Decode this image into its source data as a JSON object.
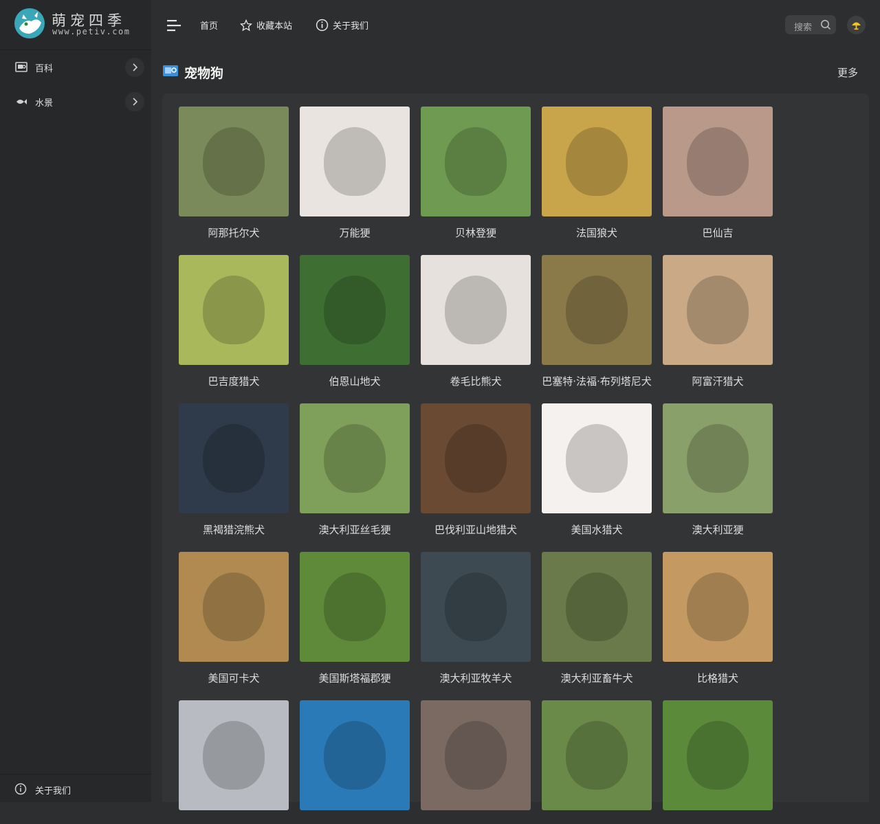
{
  "brand": {
    "name": "萌宠四季",
    "url": "www.petiv.com"
  },
  "sidebar": {
    "items": [
      {
        "label": "百科",
        "icon": "encyclopedia-icon"
      },
      {
        "label": "水景",
        "icon": "fish-icon"
      }
    ],
    "bottom": {
      "label": "关于我们",
      "icon": "info-icon"
    }
  },
  "header": {
    "menu_icon": "menu-icon",
    "nav": [
      {
        "label": "首页",
        "icon": ""
      },
      {
        "label": "收藏本站",
        "icon": "star-icon"
      },
      {
        "label": "关于我们",
        "icon": "info-icon"
      }
    ],
    "search_label": "搜索",
    "theme_icon": "theme-toggle-icon"
  },
  "section": {
    "title": "宠物狗",
    "more": "更多"
  },
  "colors": {
    "page_bg": "#2c2e2f",
    "sidebar_bg": "#262829",
    "panel_bg": "#323435",
    "accent": "#f5c518",
    "section_icon": "#3a8fd9"
  },
  "breeds": [
    {
      "name": "阿那托尔犬",
      "color": "#7a8a5a"
    },
    {
      "name": "万能㹴",
      "color": "#e9e4df"
    },
    {
      "name": "贝林登㹴",
      "color": "#6f9a52"
    },
    {
      "name": "法国狼犬",
      "color": "#c8a44a"
    },
    {
      "name": "巴仙吉",
      "color": "#b9998a"
    },
    {
      "name": "巴吉度猎犬",
      "color": "#a9b85a"
    },
    {
      "name": "伯恩山地犬",
      "color": "#3f6e32"
    },
    {
      "name": "卷毛比熊犬",
      "color": "#e6e1dc"
    },
    {
      "name": "巴塞特·法福·布列塔尼犬",
      "color": "#8a7a4a"
    },
    {
      "name": "阿富汗猎犬",
      "color": "#c9a986"
    },
    {
      "name": "黑褐猎浣熊犬",
      "color": "#2f3a4a"
    },
    {
      "name": "澳大利亚丝毛㹴",
      "color": "#7fa05a"
    },
    {
      "name": "巴伐利亚山地猎犬",
      "color": "#6a4a32"
    },
    {
      "name": "美国水猎犬",
      "color": "#f4f1ee"
    },
    {
      "name": "澳大利亚㹴",
      "color": "#8aa06a"
    },
    {
      "name": "美国可卡犬",
      "color": "#b08a50"
    },
    {
      "name": "美国斯塔福郡㹴",
      "color": "#5e8a3a"
    },
    {
      "name": "澳大利亚牧羊犬",
      "color": "#3e4a52"
    },
    {
      "name": "澳大利亚畜牛犬",
      "color": "#6a7a4a"
    },
    {
      "name": "比格猎犬",
      "color": "#c49a62"
    },
    {
      "name": "",
      "color": "#b8bcc2"
    },
    {
      "name": "",
      "color": "#2a7ab8"
    },
    {
      "name": "",
      "color": "#7a6a62"
    },
    {
      "name": "",
      "color": "#6a8a4a"
    },
    {
      "name": "",
      "color": "#5a8a3a"
    }
  ]
}
